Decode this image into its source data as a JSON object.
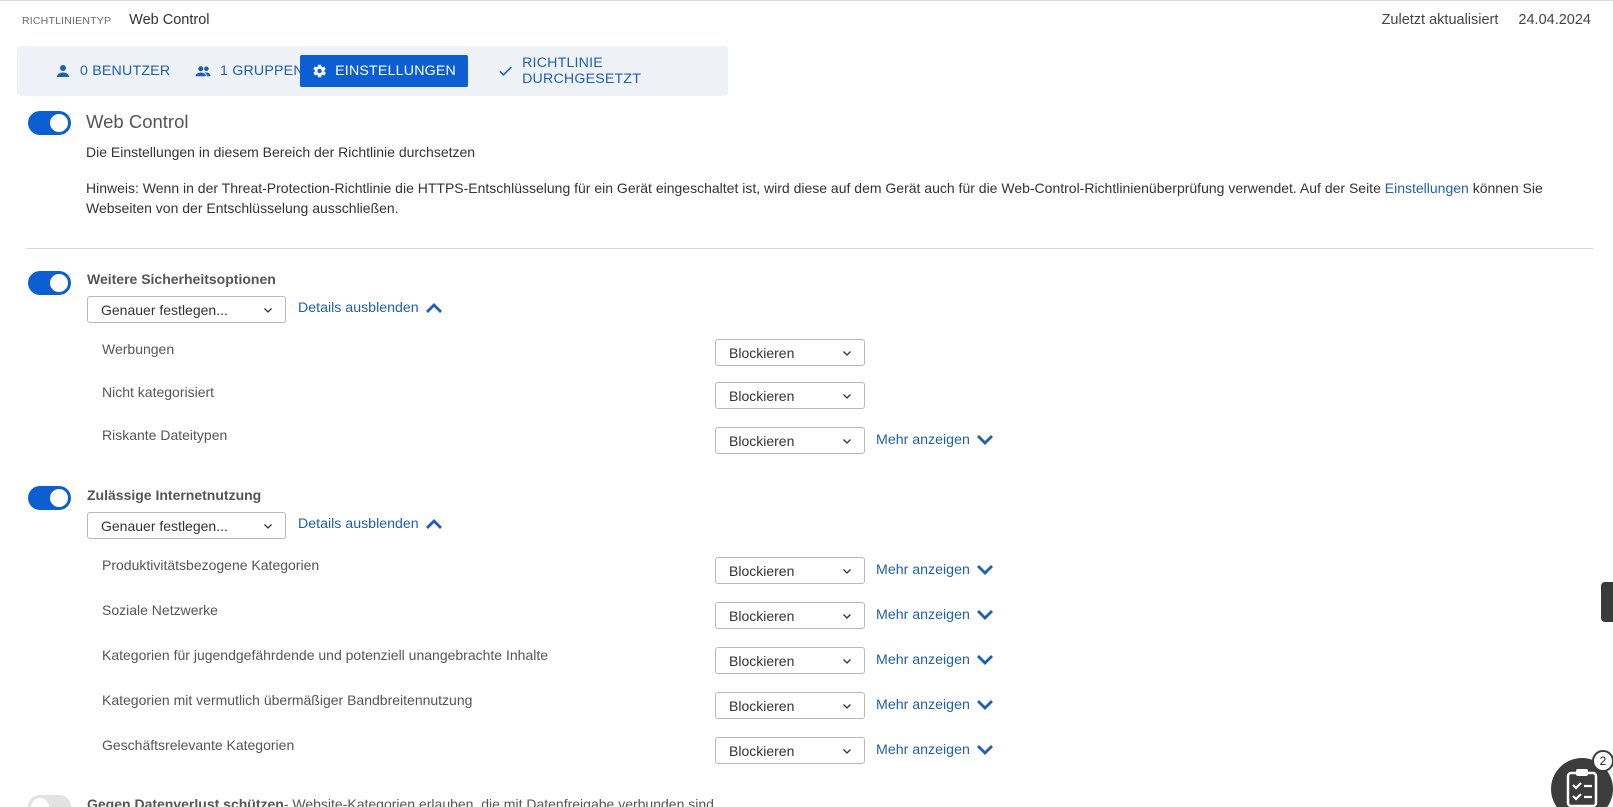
{
  "header": {
    "policy_type_label": "RICHTLINIENTYP",
    "policy_type_value": "Web Control",
    "last_updated_label": "Zuletzt aktualisiert",
    "last_updated_value": "24.04.2024"
  },
  "tabs": [
    {
      "label": "0 BENUTZER",
      "icon": "user-icon",
      "active": false
    },
    {
      "label": "1 GRUPPEN",
      "icon": "group-icon",
      "active": false
    },
    {
      "label": "EINSTELLUNGEN",
      "icon": "gear-icon",
      "active": true
    },
    {
      "label": "RICHTLINIE DURCHGESETZT",
      "icon": "check-icon",
      "active": false
    }
  ],
  "main": {
    "title": "Web Control",
    "enabled": true,
    "enforce_text": "Die Einstellungen in diesem Bereich der Richtlinie durchsetzen",
    "note_text_1": "Hinweis: Wenn in der Threat-Protection-Richtlinie die HTTPS-Entschlüsselung für ein Gerät eingeschaltet ist, wird diese auf dem Gerät auch für die Web-Control-Richtlinienüberprüfung verwendet. Auf der Seite",
    "note_link": "Einstellungen",
    "note_text_2": "können Sie Webseiten von der Entschlüsselung ausschließen."
  },
  "security_options": {
    "title": "Weitere Sicherheitsoptionen",
    "enabled": true,
    "mode_select": "Genauer festlegen...",
    "details_link": "Details ausblenden",
    "rows": [
      {
        "label": "Werbungen",
        "value": "Blockieren"
      },
      {
        "label": "Nicht kategorisiert",
        "value": "Blockieren"
      },
      {
        "label": "Riskante Dateitypen",
        "value": "Blockieren",
        "more": "Mehr anzeigen"
      }
    ]
  },
  "internet_usage": {
    "title": "Zulässige Internetnutzung",
    "enabled": true,
    "mode_select": "Genauer festlegen...",
    "details_link": "Details ausblenden",
    "rows": [
      {
        "label": "Produktivitätsbezogene Kategorien",
        "value": "Blockieren",
        "more": "Mehr anzeigen"
      },
      {
        "label": "Soziale Netzwerke",
        "value": "Blockieren",
        "more": "Mehr anzeigen"
      },
      {
        "label": "Kategorien für jugendgefährdende und potenziell unangebrachte Inhalte",
        "value": "Blockieren",
        "more": "Mehr anzeigen"
      },
      {
        "label": "Kategorien mit vermutlich übermäßiger Bandbreitennutzung",
        "value": "Blockieren",
        "more": "Mehr anzeigen"
      },
      {
        "label": "Geschäftsrelevante Kategorien",
        "value": "Blockieren",
        "more": "Mehr anzeigen"
      }
    ]
  },
  "data_loss": {
    "title": "Gegen Datenverlust schützen",
    "description": "- Website-Kategorien erlauben, die mit Datenfreigabe verbunden sind",
    "enabled": false
  },
  "widget": {
    "badge_count": "2",
    "icon": "clipboard-checklist-icon"
  },
  "colors": {
    "accent": "#0b5fd3",
    "link": "#1f5fb0",
    "tabbar_bg": "#eef1f5"
  }
}
